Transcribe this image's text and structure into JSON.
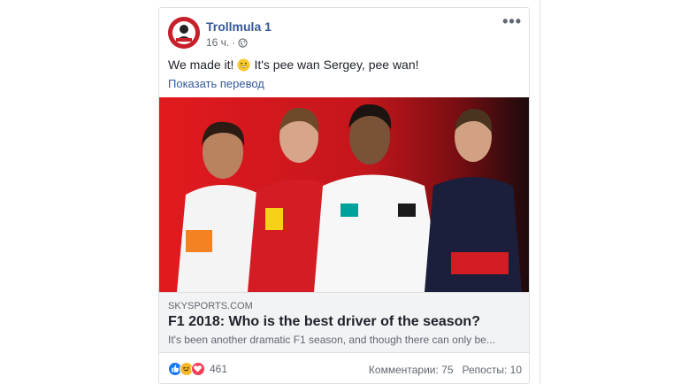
{
  "post": {
    "page_name": "Trollmula 1",
    "time": "16 ч.",
    "separator": "·",
    "privacy_icon": "globe-icon",
    "more_icon": "more-options-icon",
    "more_label": "•••",
    "text_before": "We made it!",
    "text_after": "It's pee wan Sergey, pee wan!",
    "emoji": "grinning-face-emoji",
    "translate_label": "Показать перевод"
  },
  "link": {
    "domain": "SKYSPORTS.COM",
    "title": "F1 2018: Who is the best driver of the season?",
    "description": "It's been another dramatic F1 season, and though there can only be..."
  },
  "footer": {
    "reactions": [
      "like-icon",
      "haha-icon",
      "love-icon"
    ],
    "reaction_count": "461",
    "comments_label": "Комментарии: 75",
    "shares_label": "Репосты: 10"
  },
  "colors": {
    "link_blue": "#365899",
    "image_bg_red": "#c4161c",
    "like_blue": "#1877f2",
    "haha_yellow": "#f7b928",
    "love_red": "#f33e58"
  }
}
